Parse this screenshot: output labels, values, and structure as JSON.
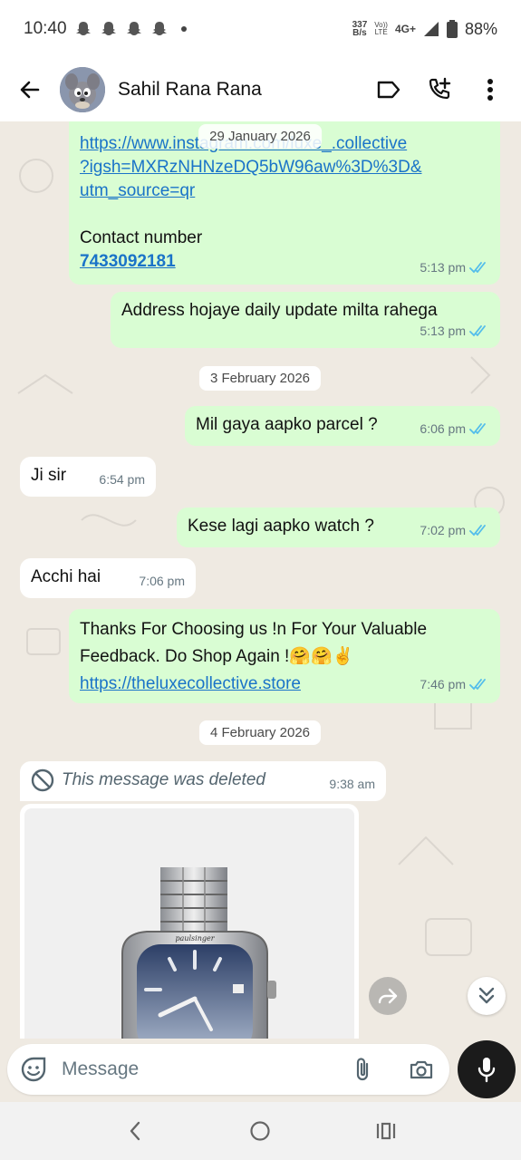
{
  "status_bar": {
    "time": "10:40",
    "net_speed_value": "337",
    "net_speed_unit": "B/s",
    "volte_top": "Vo))",
    "volte_bottom": "LTE",
    "network": "4G+",
    "battery": "88%"
  },
  "header": {
    "contact_name": "Sahil Rana Rana"
  },
  "messages": [
    {
      "direction": "outgoing",
      "date_overlay": "29 January 2026",
      "link_lines": [
        "https://www.instagram.com/luxe_.collective",
        "?igsh=MXRzNHNzeDQ5bW96aw%3D%3D&",
        "utm_source=qr"
      ],
      "text": "Contact number",
      "phone": "7433092181",
      "time": "5:13 pm"
    },
    {
      "direction": "outgoing",
      "text": "Address hojaye daily update milta rahega",
      "time": "5:13 pm"
    },
    {
      "date_chip": "3 February 2026"
    },
    {
      "direction": "outgoing",
      "text": "Mil gaya aapko parcel ?",
      "time": "6:06 pm"
    },
    {
      "direction": "incoming",
      "text": "Ji sir",
      "time": "6:54 pm"
    },
    {
      "direction": "outgoing",
      "text": "Kese lagi aapko watch ?",
      "time": "7:02 pm"
    },
    {
      "direction": "incoming",
      "text": "Acchi hai",
      "time": "7:06 pm"
    },
    {
      "direction": "outgoing",
      "lines": [
        "Thanks For Choosing us !n For Your Valuable",
        "Feedback. Do Shop Again !🤗🤗✌️"
      ],
      "link": "https://theluxecollective.store",
      "time": "7:46 pm"
    },
    {
      "date_chip": "4 February 2026"
    },
    {
      "direction": "incoming",
      "deleted_text": "This message was deleted",
      "time": "9:38 am"
    },
    {
      "direction": "incoming",
      "image": "watch-photo",
      "watch_brand": "paulsinger"
    }
  ],
  "input": {
    "placeholder": "Message"
  },
  "colors": {
    "outgoing_bubble": "#d9fdd3",
    "incoming_bubble": "#ffffff",
    "chat_background": "#efeae2",
    "read_ticks": "#53bdeb",
    "link": "#1a73c8"
  },
  "icons": {
    "back": "arrow-left-icon",
    "label": "label-icon",
    "add_call": "phone-plus-icon",
    "menu": "more-vertical-icon",
    "emoji": "sticker-icon",
    "attach": "paperclip-icon",
    "camera": "camera-icon",
    "mic": "mic-icon",
    "forward": "forward-icon",
    "scroll_down": "double-chevron-down-icon"
  }
}
